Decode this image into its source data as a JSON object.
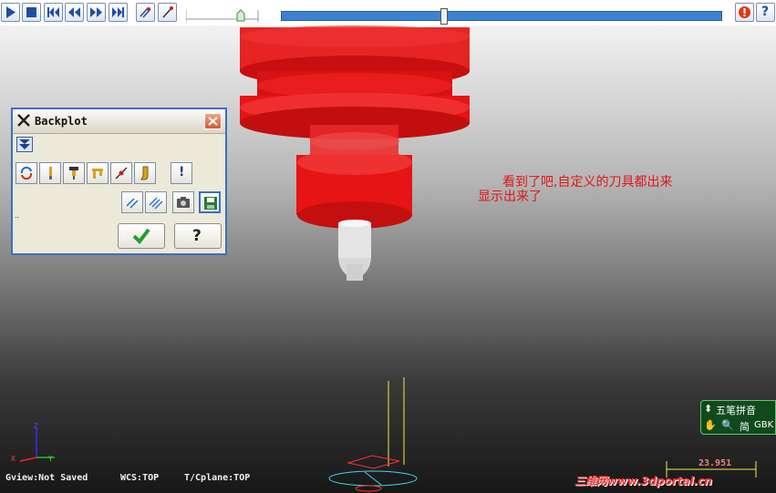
{
  "toolbar": {
    "buttons": [
      {
        "icon": "play-icon"
      },
      {
        "icon": "stop-icon"
      },
      {
        "icon": "skip-start-icon"
      },
      {
        "icon": "step-back-icon"
      },
      {
        "icon": "step-forward-icon"
      },
      {
        "icon": "skip-end-icon"
      },
      {
        "icon": "trail-display-icon"
      },
      {
        "icon": "tool-display-icon"
      }
    ],
    "right_buttons": [
      {
        "icon": "stop-condition-icon"
      },
      {
        "icon": "help-icon",
        "label": "?"
      }
    ]
  },
  "dialog": {
    "title": "Backplot",
    "title_icon": "x-logo-icon",
    "close_icon": "close-icon",
    "expand_icon": "expand-down-icon",
    "row1_icons": [
      "cycle-icon",
      "tool-icon",
      "holder-icon",
      "axis-tool-icon",
      "rapid-icon",
      "shank-icon"
    ],
    "info_icon": "exclamation-icon",
    "info_label": "!",
    "row2_icons": [
      "verify-icon",
      "hatch-icon",
      "camera-icon",
      "save-icon"
    ],
    "dots": "..",
    "ok_icon": "checkmark-icon",
    "help_label": "?"
  },
  "annotation": {
    "line1": "看到了吧,自定义的刀具都出来",
    "line2": "显示出来了"
  },
  "status": {
    "gview": "Gview:Not Saved",
    "wcs": "WCS:TOP",
    "tcplane": "T/Cplane:TOP"
  },
  "ime": {
    "row1": "五笔拼音",
    "row2_mode": "简",
    "row2_code": "GBK"
  },
  "axes": {
    "x": "X",
    "y": "Y",
    "z": "Z"
  },
  "dimension_value": "23.951",
  "watermark": "三维网www.3dportal.cn",
  "colors": {
    "tool_red": "#e61414",
    "cutter_white": "#e6e6e6",
    "timeline_blue": "#3c82d2",
    "annotation_red": "#e01818",
    "ime_green": "#0f4a1c"
  }
}
